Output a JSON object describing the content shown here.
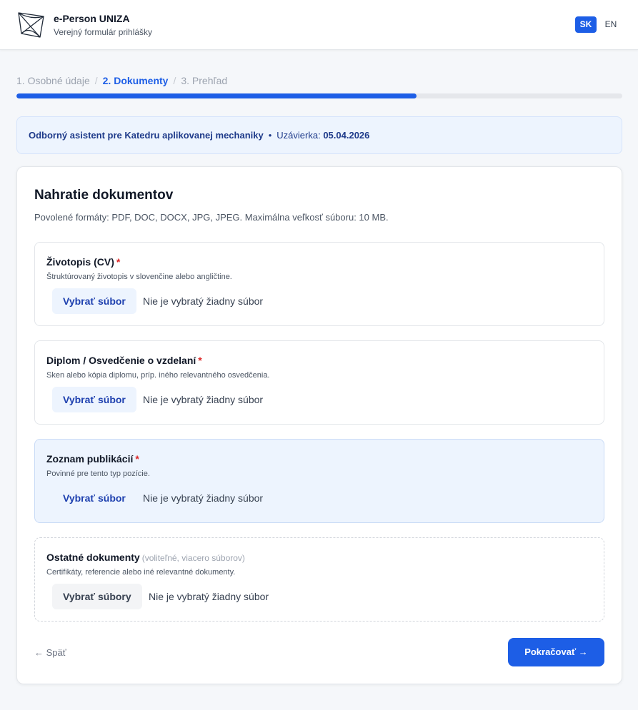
{
  "header": {
    "app_title": "e-Person UNIZA",
    "app_subtitle": "Verejný formulár prihlášky",
    "languages": [
      {
        "code": "SK",
        "active": true
      },
      {
        "code": "EN",
        "active": false
      }
    ]
  },
  "stepper": {
    "steps": [
      {
        "label": "1. Osobné údaje",
        "state": "done"
      },
      {
        "label": "2. Dokumenty",
        "state": "active"
      },
      {
        "label": "3. Prehľad",
        "state": "pending"
      }
    ],
    "separator": "/",
    "progress_percent": 66
  },
  "banner": {
    "position": "Odborný asistent pre Katedru aplikovanej mechaniky",
    "bullet": "•",
    "deadline_label": "Uzávierka:",
    "deadline_value": "05.04.2026"
  },
  "upload": {
    "title": "Nahratie dokumentov",
    "subtitle": "Povolené formáty: PDF, DOC, DOCX, JPG, JPEG. Maximálna veľkosť súboru: 10 MB.",
    "required_mark": "*",
    "documents": [
      {
        "title": "Životopis (CV)",
        "required": true,
        "description": "Štruktúrovaný životopis v slovenčine alebo angličtine.",
        "button": "Vybrať súbor",
        "status": "Nie je vybratý žiadny súbor"
      },
      {
        "title": "Diplom / Osvedčenie o vzdelaní",
        "required": true,
        "description": "Sken alebo kópia diplomu, príp. iného relevantného osvedčenia.",
        "button": "Vybrať súbor",
        "status": "Nie je vybratý žiadny súbor"
      },
      {
        "title": "Zoznam publikácií",
        "required": true,
        "description": "Povinné pre tento typ pozície.",
        "button": "Vybrať súbor",
        "status": "Nie je vybratý žiadny súbor"
      },
      {
        "title": "Ostatné dokumenty",
        "note": "(voliteľné, viacero súborov)",
        "required": false,
        "description": "Certifikáty, referencie alebo iné relevantné dokumenty.",
        "button": "Vybrať súbory",
        "status": "Nie je vybratý žiadny súbor"
      }
    ]
  },
  "footer": {
    "back_label": "← Späť",
    "continue_label": "Pokračovať →"
  },
  "colors": {
    "accent": "#1d5ee6",
    "required": "#dc2626",
    "highlight_bg": "#edf4fe"
  }
}
